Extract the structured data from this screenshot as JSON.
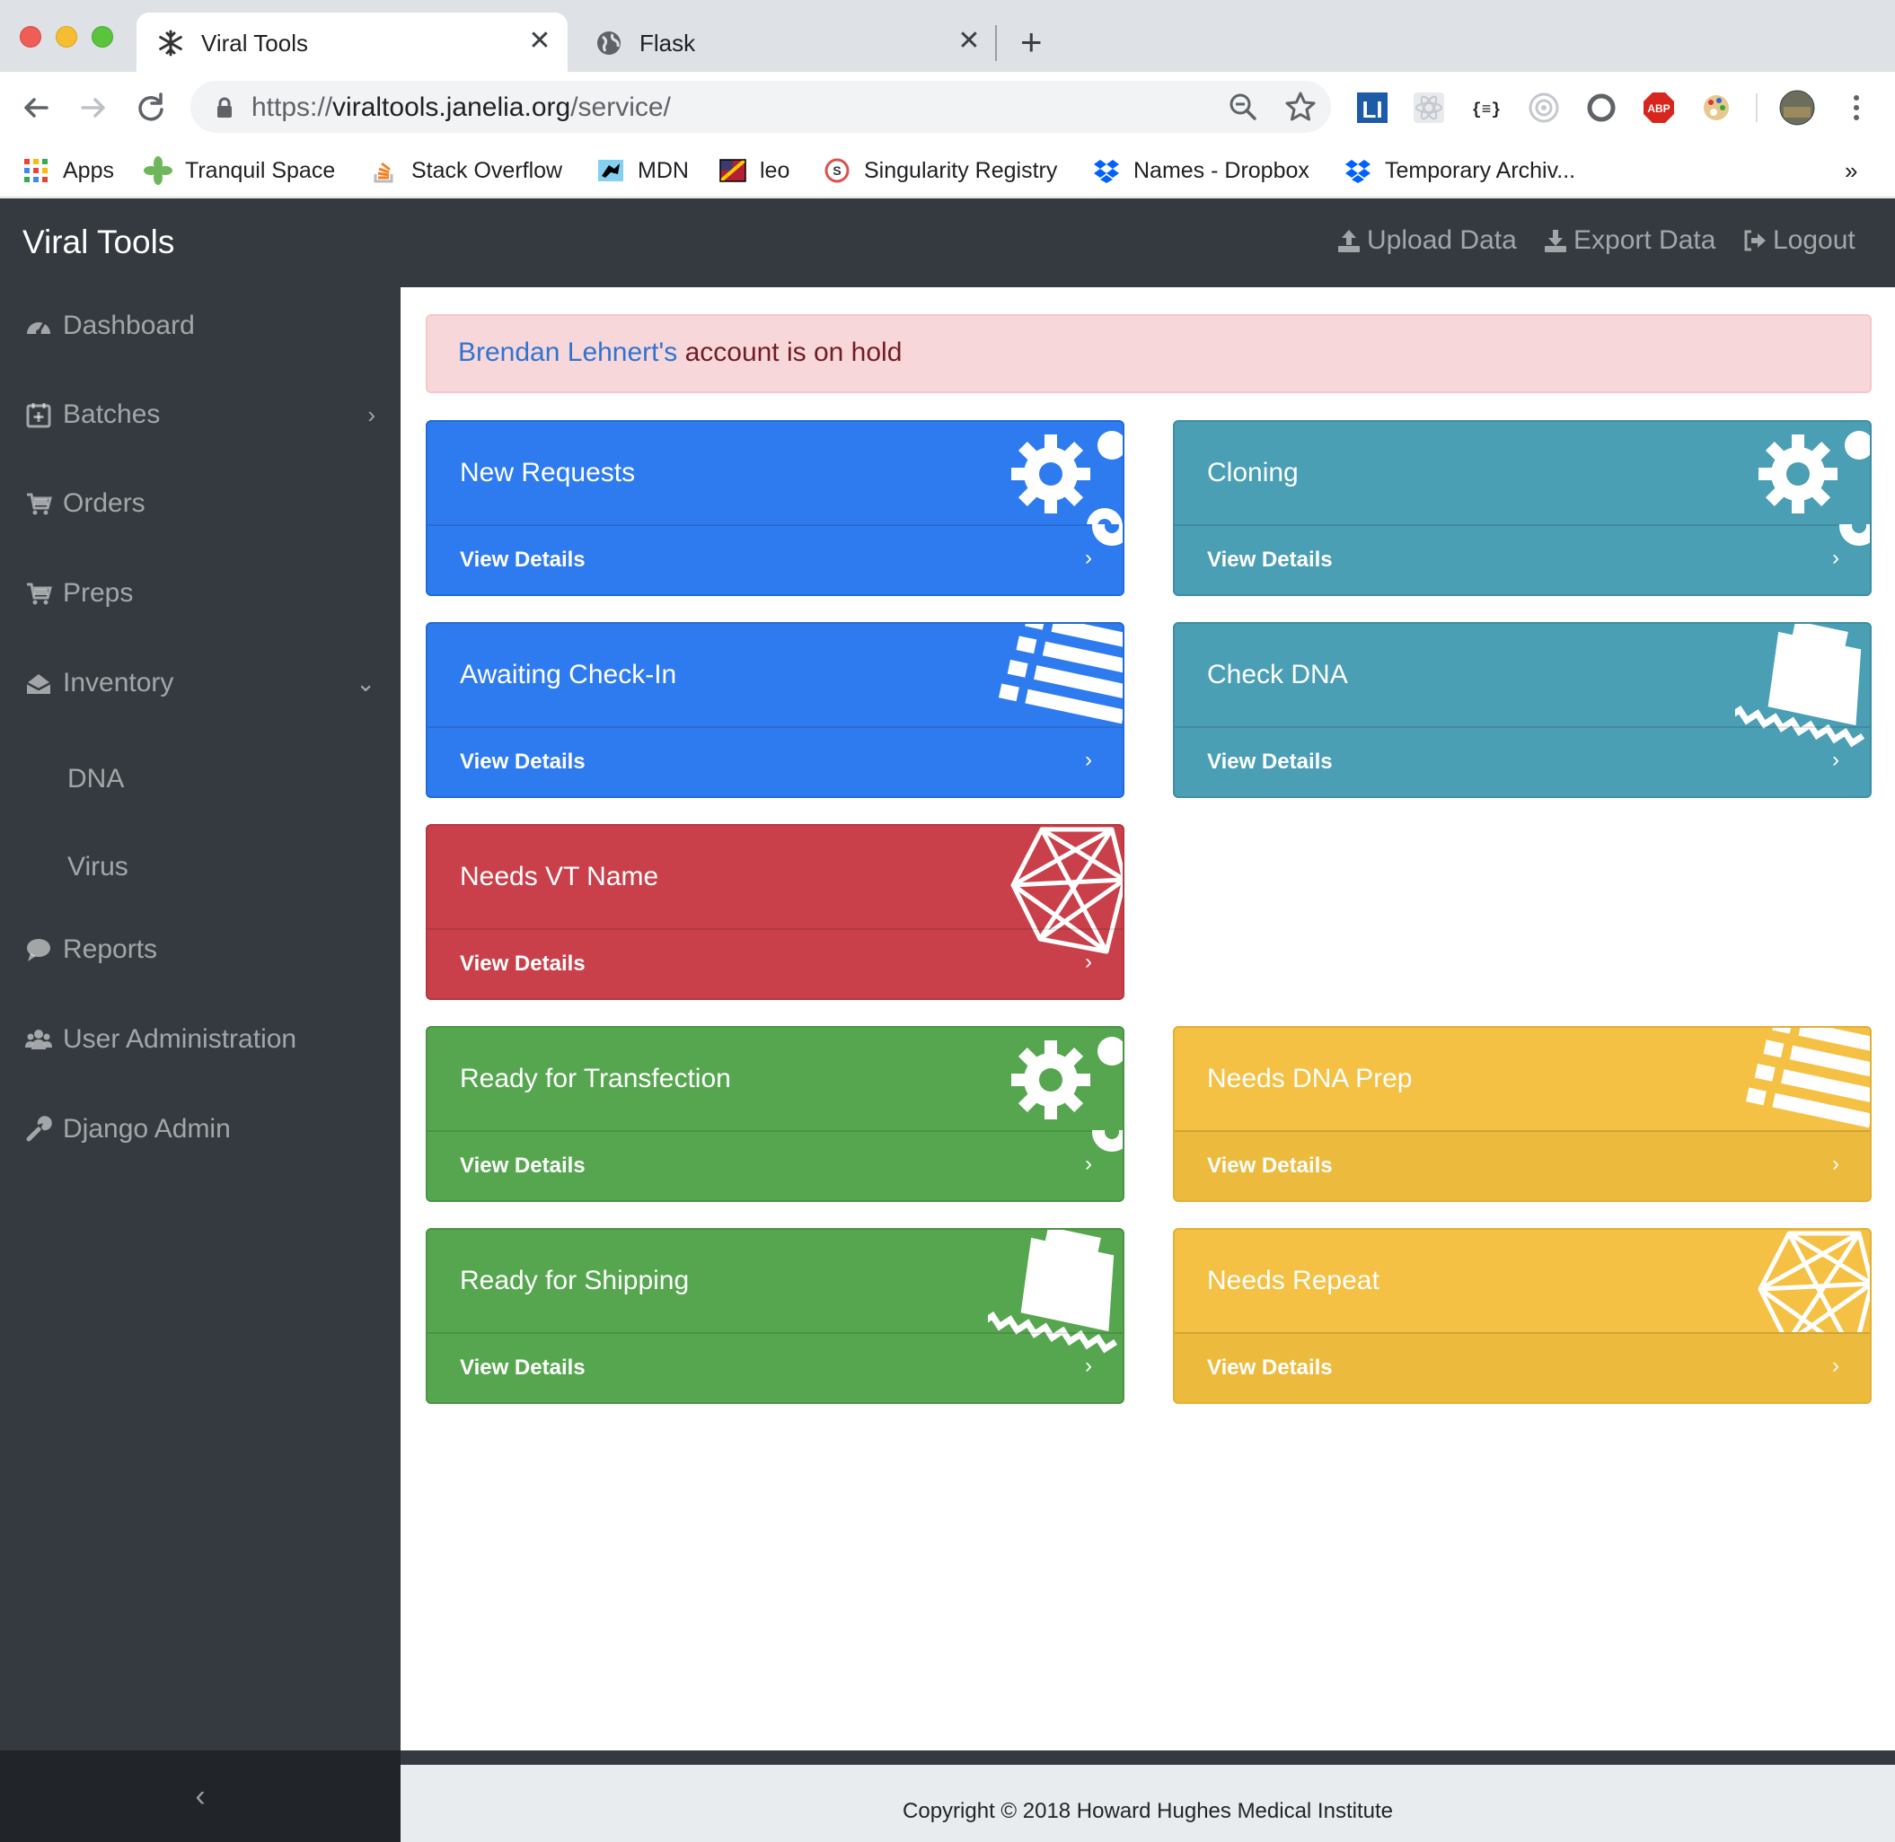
{
  "browser": {
    "tabs": [
      {
        "title": "Viral Tools",
        "active": true,
        "icon": "snowflake-icon"
      },
      {
        "title": "Flask",
        "active": false,
        "icon": "globe-icon"
      }
    ],
    "url": {
      "scheme": "https://",
      "host": "viraltools.janelia.org",
      "path": "/service/"
    },
    "bookmarks": [
      {
        "label": "Apps",
        "icon": "apps-grid-icon"
      },
      {
        "label": "Tranquil Space",
        "icon": "pinwheel-icon"
      },
      {
        "label": "Stack Overflow",
        "icon": "stackoverflow-icon"
      },
      {
        "label": "MDN",
        "icon": "mdn-icon"
      },
      {
        "label": "leo",
        "icon": "leo-flag-icon"
      },
      {
        "label": "Singularity Registry",
        "icon": "singularity-icon"
      },
      {
        "label": "Names - Dropbox",
        "icon": "dropbox-icon"
      },
      {
        "label": "Temporary Archiv...",
        "icon": "dropbox-icon"
      }
    ],
    "more_bookmarks": "»"
  },
  "navbar": {
    "brand": "Viral Tools",
    "links": [
      {
        "label": "Upload Data",
        "icon": "upload-icon"
      },
      {
        "label": "Export Data",
        "icon": "download-icon"
      },
      {
        "label": "Logout",
        "icon": "sign-out-icon"
      }
    ]
  },
  "sidebar": {
    "items": [
      {
        "label": "Dashboard",
        "icon": "dashboard-icon"
      },
      {
        "label": "Batches",
        "icon": "calendar-plus-icon",
        "caret": "›"
      },
      {
        "label": "Orders",
        "icon": "cart-icon"
      },
      {
        "label": "Preps",
        "icon": "cart-icon"
      },
      {
        "label": "Inventory",
        "icon": "inbox-icon",
        "caret": "⌄"
      },
      {
        "label": "Reports",
        "icon": "comment-icon"
      },
      {
        "label": "User Administration",
        "icon": "users-icon"
      },
      {
        "label": "Django Admin",
        "icon": "wrench-icon"
      }
    ],
    "inventory_sub": [
      "DNA",
      "Virus"
    ],
    "toggle": "‹"
  },
  "alert": {
    "user": "Brendan Lehnert's",
    "message": " account is on hold"
  },
  "cards": [
    {
      "title": "New Requests",
      "footer": "View Details",
      "chevron": "›",
      "color": "#2e7bf0",
      "icon": "gears-icon"
    },
    {
      "title": "Cloning",
      "footer": "View Details",
      "chevron": "›",
      "color": "#4a9fb5",
      "icon": "gears-icon"
    },
    {
      "title": "Awaiting Check-In",
      "footer": "View Details",
      "chevron": "›",
      "color": "#2e7bf0",
      "icon": "list-icon"
    },
    {
      "title": "Check DNA",
      "footer": "View Details",
      "chevron": "›",
      "color": "#4a9fb5",
      "icon": "ship-icon"
    },
    {
      "title": "Needs VT Name",
      "footer": "View Details",
      "chevron": "›",
      "color": "#c9404a",
      "icon": "polyhedron-icon"
    },
    {
      "title": "Ready for Transfection",
      "footer": "View Details",
      "chevron": "›",
      "color": "#56a650",
      "icon": "gears-icon"
    },
    {
      "title": "Needs DNA Prep",
      "footer": "View Details",
      "chevron": "›",
      "color": "#f4c144",
      "icon": "list-icon"
    },
    {
      "title": "Ready for Shipping",
      "footer": "View Details",
      "chevron": "›",
      "color": "#56a650",
      "icon": "ship-icon"
    },
    {
      "title": "Needs Repeat",
      "footer": "View Details",
      "chevron": "›",
      "color": "#f4c144",
      "icon": "polyhedron-icon"
    }
  ],
  "footer": {
    "copyright": "Copyright © 2018 Howard Hughes Medical Institute"
  }
}
